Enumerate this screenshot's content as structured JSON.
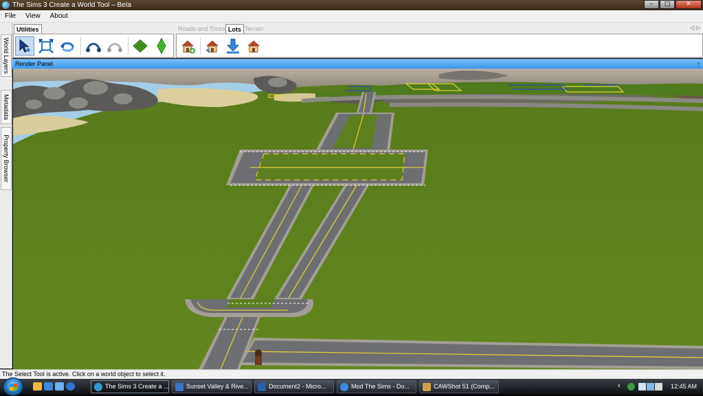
{
  "window": {
    "title": "The Sims 3 Create a World Tool – Beta",
    "buttons": {
      "minimize": "–",
      "maximize": "□",
      "close": "✕"
    }
  },
  "menu": [
    "File",
    "View",
    "About"
  ],
  "left_dock": [
    "World Layers",
    "Metadata",
    "Property Browser"
  ],
  "ribbon": {
    "tabs": [
      "Utilities",
      "Roads and Trees",
      "Lots",
      "Terrain"
    ],
    "active_tabs": [
      "Utilities",
      "Lots"
    ],
    "arrows": "◁ ▷",
    "utilities_tools": [
      "select-arrow-icon",
      "transform-handles-icon",
      "rotate-view-icon",
      "road-node-icon",
      "road-node-disabled-icon",
      "terrain-grid-icon",
      "sim-plumbob-icon"
    ],
    "lots_tools": [
      "add-lot-house-icon",
      "edit-lot-house-icon",
      "import-lot-download-icon",
      "lot-house-sparkle-icon"
    ]
  },
  "render_panel": {
    "title": "Render Panel",
    "pin": "↑"
  },
  "status": "The Select Tool is active. Click on a world object to select it.",
  "taskbar": {
    "tasks": [
      {
        "label": "The Sims 3 Create a ...",
        "active": true,
        "color": "#2f9bd6"
      },
      {
        "label": "Sunset Valley & Rive...",
        "active": false,
        "color": "#3a72c8"
      },
      {
        "label": "Document2 - Micro...",
        "active": false,
        "color": "#2b5fae"
      },
      {
        "label": "Mod The Sims - Do...",
        "active": false,
        "color": "#3d8be0"
      },
      {
        "label": "CAWShot 51 (Comp...",
        "active": false,
        "color": "#c9a24a"
      }
    ],
    "tray_arrow": "‹",
    "clock": "12:45 AM"
  },
  "colors": {
    "grass": "#5d7f1f",
    "road": "#6e7073",
    "road_edge": "#a9a59b",
    "lane_yellow": "#e3c93a",
    "water": "#9ec9e4",
    "sand": "#d8cc9a",
    "accent_blue": "#3b97ef"
  }
}
